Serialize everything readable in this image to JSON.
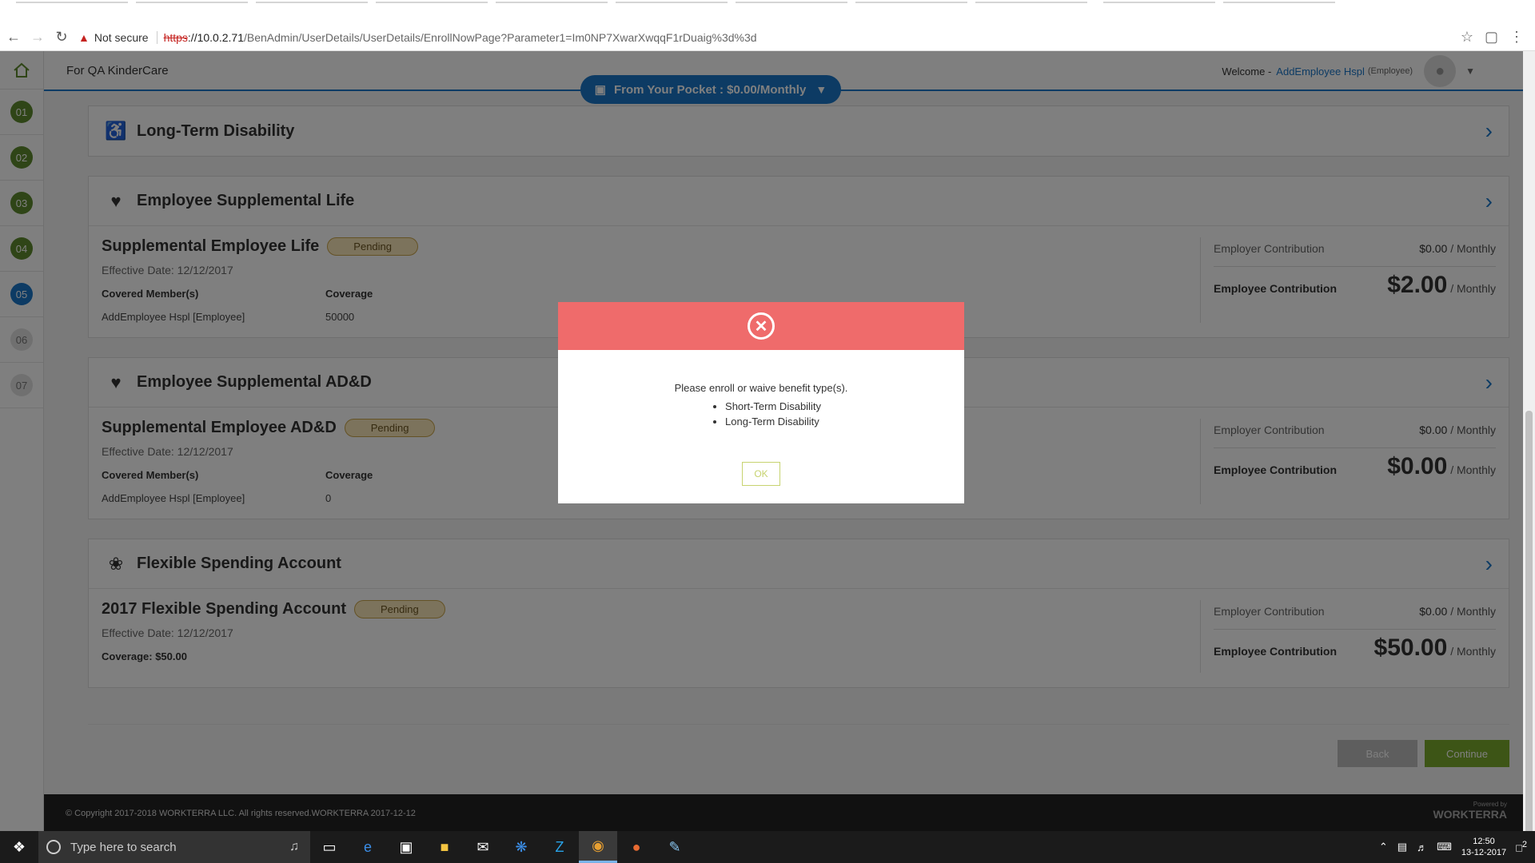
{
  "browser": {
    "not_secure": "Not secure",
    "url_scheme": "https",
    "url_host": "://10.0.2.71",
    "url_path": "/BenAdmin/UserDetails/UserDetails/EnrollNowPage?Parameter1=Im0NP7XwarXwqqF1rDuaig%3d%3d"
  },
  "header": {
    "org_name": "For QA KinderCare",
    "pocket_label": "From Your Pocket : $0.00/Monthly",
    "welcome_label": "Welcome -",
    "user_name": "AddEmployee Hspl",
    "user_role": "(Employee)"
  },
  "steps": [
    "01",
    "02",
    "03",
    "04",
    "05",
    "06",
    "07"
  ],
  "cards": {
    "ltd": {
      "title": "Long-Term Disability"
    },
    "supp_life": {
      "title": "Employee Supplemental Life",
      "plan": "Supplemental Employee Life",
      "status": "Pending",
      "effective": "Effective Date: 12/12/2017",
      "covered_hdr": "Covered Member(s)",
      "coverage_hdr": "Coverage",
      "member": "AddEmployee Hspl [Employee]",
      "coverage": "50000",
      "employer_label": "Employer Contribution",
      "employer_value": "$0.00",
      "employer_period": "/ Monthly",
      "employee_label": "Employee Contribution",
      "employee_value": "$2.00",
      "employee_period": "/ Monthly"
    },
    "supp_add": {
      "title": "Employee Supplemental AD&D",
      "plan": "Supplemental Employee AD&D",
      "status": "Pending",
      "effective": "Effective Date: 12/12/2017",
      "covered_hdr": "Covered Member(s)",
      "coverage_hdr": "Coverage",
      "member": "AddEmployee Hspl [Employee]",
      "coverage": "0",
      "employer_label": "Employer Contribution",
      "employer_value": "$0.00",
      "employer_period": "/ Monthly",
      "employee_label": "Employee Contribution",
      "employee_value": "$0.00",
      "employee_period": "/ Monthly"
    },
    "fsa": {
      "title": "Flexible Spending Account",
      "plan": "2017 Flexible Spending Account",
      "status": "Pending",
      "effective": "Effective Date: 12/12/2017",
      "coverage_line": "Coverage: $50.00",
      "employer_label": "Employer Contribution",
      "employer_value": "$0.00",
      "employer_period": "/ Monthly",
      "employee_label": "Employee Contribution",
      "employee_value": "$50.00",
      "employee_period": "/ Monthly"
    }
  },
  "actions": {
    "back": "Back",
    "continue": "Continue"
  },
  "footer": {
    "copyright": "© Copyright 2017-2018 WORKTERRA LLC. All rights reserved.WORKTERRA 2017-12-12",
    "powered_by": "Powered by",
    "brand": "WORKTERRA"
  },
  "modal": {
    "message": "Please enroll or waive benefit type(s).",
    "items": [
      "Short-Term Disability",
      "Long-Term Disability"
    ],
    "ok": "OK"
  },
  "taskbar": {
    "search_placeholder": "Type here to search",
    "time": "12:50",
    "date": "13-12-2017",
    "notifications": "2"
  }
}
